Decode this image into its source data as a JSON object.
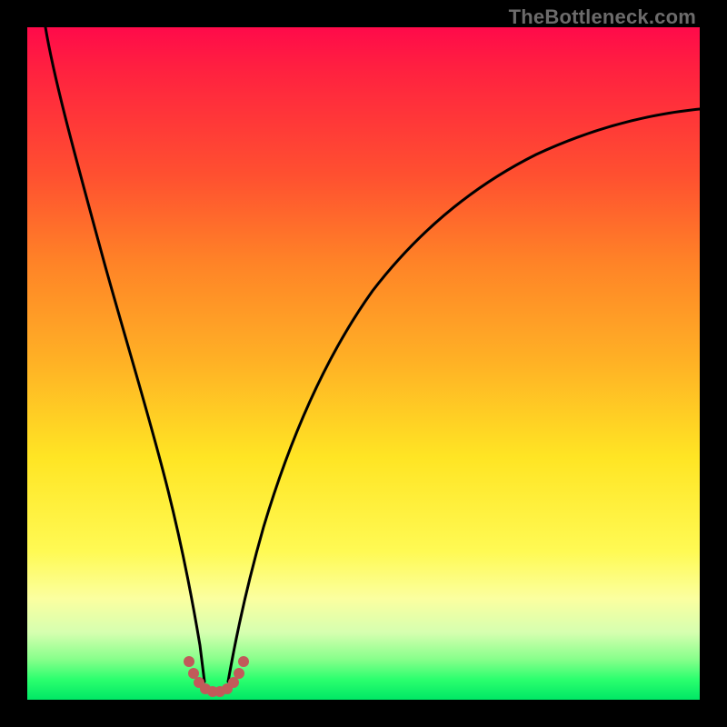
{
  "watermark": "TheBottleneck.com",
  "colors": {
    "background": "#000000",
    "curve": "#000000",
    "markers": "#c15a5a",
    "gradient_stops": [
      "#ff0a4a",
      "#ff5030",
      "#ff8327",
      "#ffb225",
      "#ffe524",
      "#fbffa0",
      "#2bff6e",
      "#00e765"
    ]
  },
  "chart_data": {
    "type": "line",
    "title": "",
    "xlabel": "",
    "ylabel": "",
    "xlim": [
      0,
      1
    ],
    "ylim": [
      0,
      1
    ],
    "series": [
      {
        "name": "left-branch",
        "x": [
          0.0,
          0.02,
          0.04,
          0.06,
          0.08,
          0.1,
          0.12,
          0.14,
          0.16,
          0.18,
          0.2,
          0.215,
          0.23,
          0.245,
          0.255
        ],
        "y": [
          1.0,
          0.955,
          0.905,
          0.855,
          0.8,
          0.745,
          0.68,
          0.61,
          0.535,
          0.45,
          0.35,
          0.26,
          0.17,
          0.085,
          0.025
        ]
      },
      {
        "name": "right-branch",
        "x": [
          0.29,
          0.305,
          0.32,
          0.34,
          0.37,
          0.4,
          0.44,
          0.48,
          0.52,
          0.57,
          0.62,
          0.68,
          0.74,
          0.8,
          0.86,
          0.92,
          1.0
        ],
        "y": [
          0.025,
          0.085,
          0.16,
          0.24,
          0.33,
          0.405,
          0.48,
          0.545,
          0.595,
          0.645,
          0.69,
          0.735,
          0.77,
          0.8,
          0.825,
          0.845,
          0.87
        ]
      },
      {
        "name": "valley-marker",
        "x": [
          0.235,
          0.245,
          0.255,
          0.265,
          0.275,
          0.285,
          0.295,
          0.305,
          0.315
        ],
        "y": [
          0.055,
          0.035,
          0.02,
          0.012,
          0.01,
          0.012,
          0.02,
          0.035,
          0.055
        ]
      }
    ],
    "annotation": "V-shaped bottleneck curve on rainbow heat gradient; minimum near x≈0.27"
  }
}
